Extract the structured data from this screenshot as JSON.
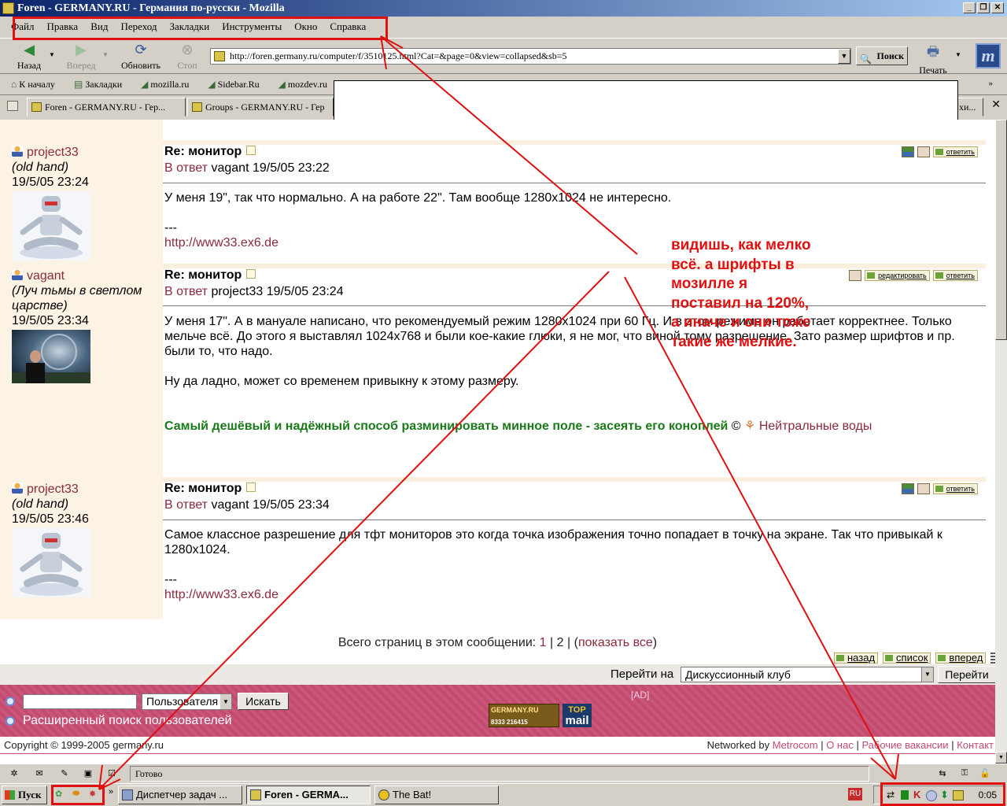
{
  "window": {
    "title": "Foren - GERMANY.RU - Германия по-русски - Mozilla"
  },
  "menu": [
    "Файл",
    "Правка",
    "Вид",
    "Переход",
    "Закладки",
    "Инструменты",
    "Окно",
    "Справка"
  ],
  "nav": {
    "back": "Назад",
    "forward": "Вперед",
    "reload": "Обновить",
    "stop": "Стоп",
    "search": "Поиск",
    "print": "Печать",
    "url": "http://foren.germany.ru/computer/f/3510125.html?Cat=&page=0&view=collapsed&sb=5"
  },
  "bookmarks": [
    "К началу",
    "Закладки",
    "mozilla.ru",
    "Sidebar.Ru",
    "mozdev.ru"
  ],
  "tabs": [
    "Foren - GERMANY.RU - Гер...",
    "Groups - GERMANY.RU - Гер",
    "хи..."
  ],
  "posts": [
    {
      "author": "project33",
      "rank": "(old hand)",
      "date": "19/5/05 23:24",
      "title": "Re: монитор",
      "reply_label": "В ответ",
      "reply_to": "vagant 19/5/05 23:22",
      "body": "У меня 19\", так что нормально. А на работе 22\". Там вообще 1280х1024 не интересно.",
      "sigsep": "---",
      "link": "http://www33.ex6.de"
    },
    {
      "author": "vagant",
      "rank": "(Луч тьмы в светлом царстве)",
      "date": "19/5/05 23:34",
      "title": "Re: монитор",
      "reply_label": "В ответ",
      "reply_to": "project33 19/5/05 23:24",
      "body": "У меня 17\". А в мануале написано, что рекомендуемый режим 1280х1024 при 60 Гц. И в этом режиме он работает корректнее. Только мельче всё. До этого я выставлял 1024х768 и были кое-какие глюки, я не мог, что виной тому разрешение. Зато размер шрифтов и пр. были то, что надо.",
      "body2": "Ну да ладно, может со временем привыкну к этому размеру.",
      "sig": "Самый дешёвый и надёжный способ разминировать минное поле - засеять его коноплей",
      "copy": "©",
      "siglink": "Нейтральные воды"
    },
    {
      "author": "project33",
      "rank": "(old hand)",
      "date": "19/5/05 23:46",
      "title": "Re: монитор",
      "reply_label": "В ответ",
      "reply_to": "vagant 19/5/05 23:34",
      "body": "Самое классное разрешение для тфт мониторов это когда точка изображения точно попадает в точку на экране. Так что привыкай к 1280х1024.",
      "sigsep": "---",
      "link": "http://www33.ex6.de"
    }
  ],
  "actions": {
    "reply": "ответить",
    "edit": "редактировать",
    "back": "назад",
    "list": "список",
    "next": "вперед"
  },
  "pagination": {
    "label": "Всего страниц в этом сообщении:",
    "p1": "1",
    "sep": "|",
    "p2": "2",
    "show_all": "(показать все)",
    "show_all_link": "показать все"
  },
  "goto": {
    "label": "Перейти на",
    "value": "Дискуссионный клуб",
    "button": "Перейти"
  },
  "footer": {
    "select": "Пользователя",
    "search_button": "Искать",
    "advanced": "Расширенный поиск пользователей",
    "ad": "[AD]",
    "banner1": "GERMANY.RU",
    "banner1_nums": "8333  216415",
    "banner2_top": "TOP",
    "banner2_mail": "mail"
  },
  "copyright": "Copyright © 1999-2005 germany.ru",
  "network": {
    "prefix": "Networked by",
    "metrocom": "Metrocom",
    "about": "О нас",
    "jobs": "Рабочие вакансии",
    "contact": "Контакт"
  },
  "status": "Готово",
  "taskbar": {
    "start": "Пуск",
    "tasks": [
      "Диспетчер задач ...",
      "Foren - GERMA...",
      "The Bat!"
    ],
    "lang": "RU",
    "clock": "0:05"
  },
  "annotation": {
    "lines": [
      "видишь, как мелко",
      "всё. а шрифты в",
      "мозилле я",
      "поставил на 120%,",
      "а иначе и они тоже",
      "такие же мелкие."
    ]
  }
}
